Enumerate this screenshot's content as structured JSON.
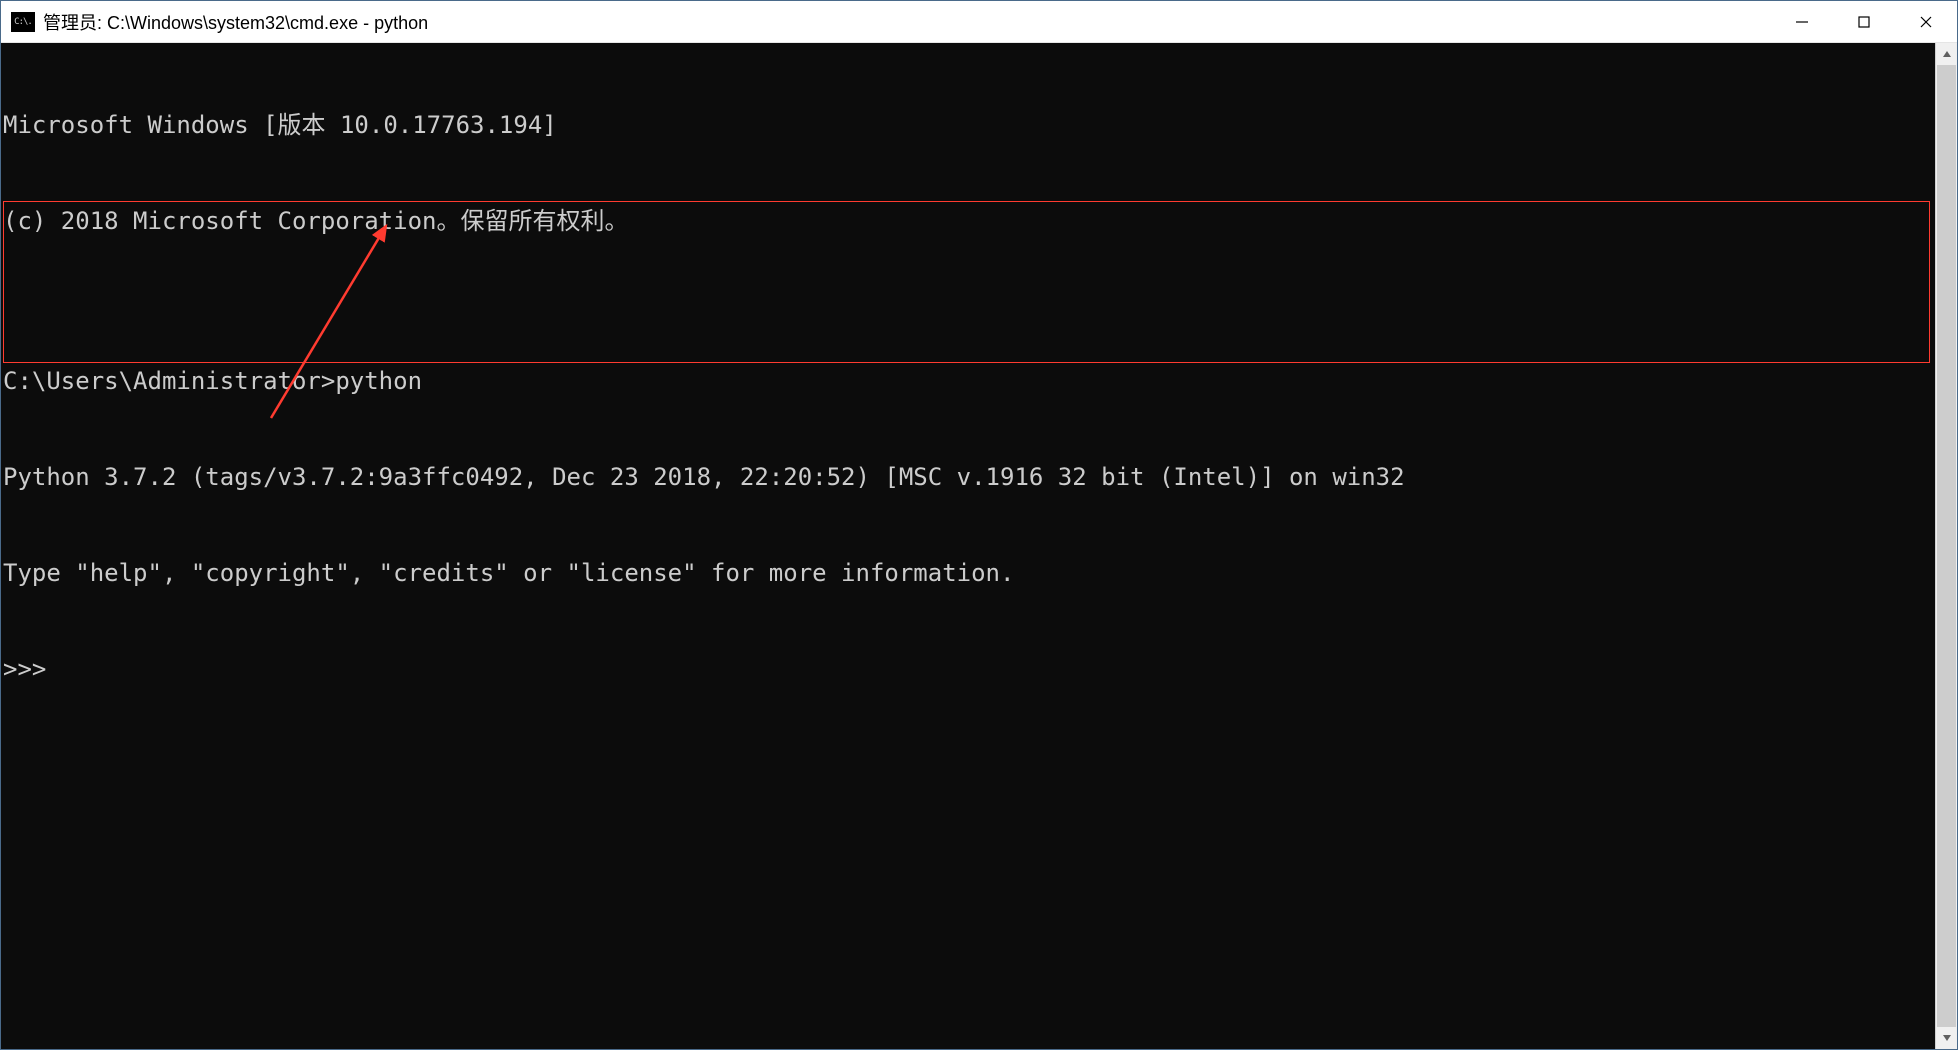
{
  "window": {
    "title": "管理员: C:\\Windows\\system32\\cmd.exe - python",
    "icon_label": "C:\\."
  },
  "terminal": {
    "lines": [
      "Microsoft Windows [版本 10.0.17763.194]",
      "(c) 2018 Microsoft Corporation。保留所有权利。",
      "",
      "C:\\Users\\Administrator>python",
      "Python 3.7.2 (tags/v3.7.2:9a3ffc0492, Dec 23 2018, 22:20:52) [MSC v.1916 32 bit (Intel)] on win32",
      "Type \"help\", \"copyright\", \"credits\" or \"license\" for more information.",
      ">>>"
    ]
  },
  "annotation": {
    "color": "#ff3b30"
  }
}
